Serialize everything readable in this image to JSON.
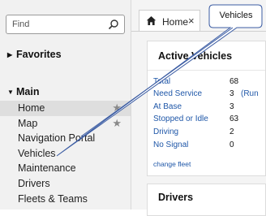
{
  "search": {
    "placeholder": "Find"
  },
  "sidebar": {
    "favorites_label": "Favorites",
    "main_label": "Main",
    "items": [
      {
        "label": "Home",
        "starred": true,
        "active": true
      },
      {
        "label": "Map",
        "starred": true
      },
      {
        "label": "Navigation Portal"
      },
      {
        "label": "Vehicles"
      },
      {
        "label": "Maintenance"
      },
      {
        "label": "Drivers"
      },
      {
        "label": "Fleets & Teams"
      }
    ]
  },
  "tab": {
    "label": "Home",
    "icon": "home-icon"
  },
  "active_vehicles": {
    "title": "Active Vehicles",
    "rows": [
      {
        "label": "Total",
        "value": "68"
      },
      {
        "label": "Need Service",
        "value": "3",
        "extra": "(Run"
      },
      {
        "label": "At Base",
        "value": "3"
      },
      {
        "label": "Stopped or Idle",
        "value": "63"
      },
      {
        "label": "Driving",
        "value": "2"
      },
      {
        "label": "No Signal",
        "value": "0"
      }
    ],
    "change_fleet": "change fleet"
  },
  "drivers": {
    "title": "Drivers"
  },
  "callout": {
    "text": "Vehicles"
  },
  "colors": {
    "link": "#1f57a8",
    "sidebar_bg": "#f1f1f1",
    "active_bg": "#dedede"
  }
}
